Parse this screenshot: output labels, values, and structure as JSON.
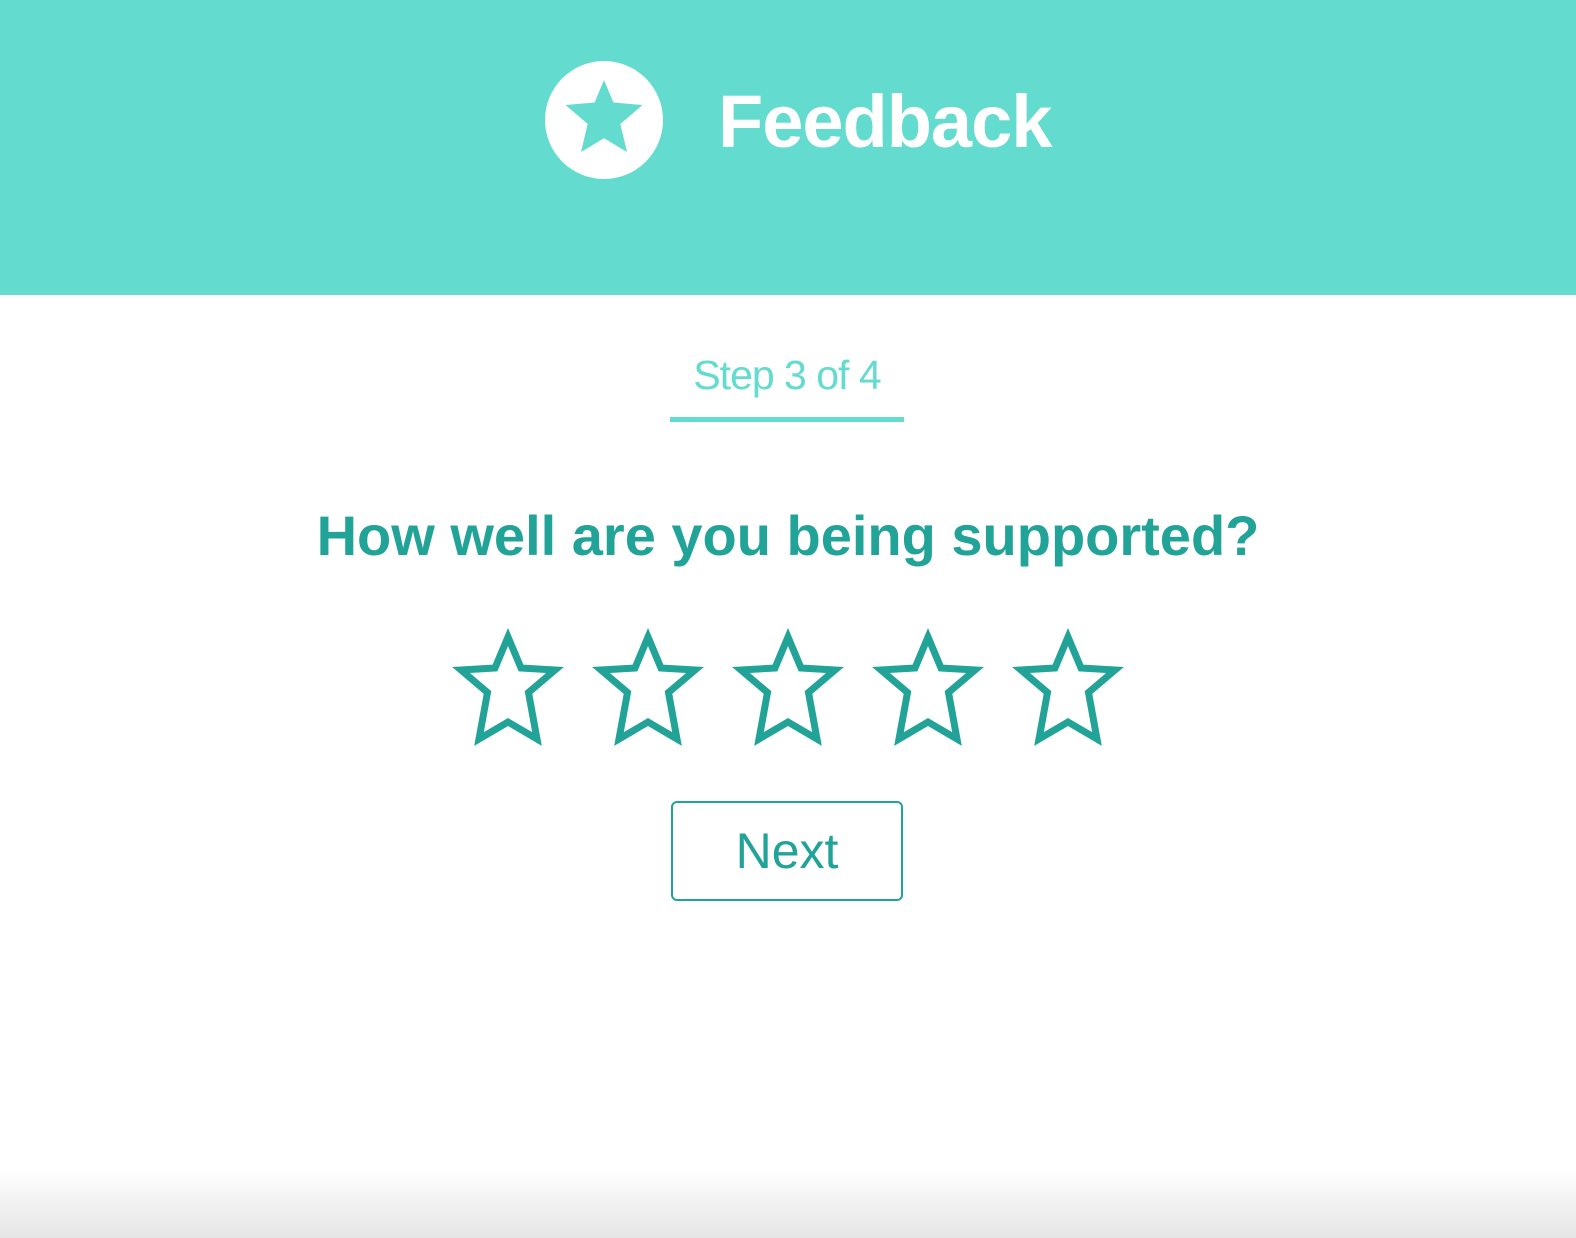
{
  "header": {
    "title": "Feedback",
    "logo_icon": "star-icon",
    "background_color": "#63dbce",
    "text_color": "#ffffff"
  },
  "progress": {
    "label": "Step 3 of 4",
    "current_step": 3,
    "total_steps": 4,
    "color": "#63dbce"
  },
  "question": {
    "text": "How well are you being supported?",
    "color": "#22a398"
  },
  "rating": {
    "max_stars": 5,
    "selected": 0,
    "star_icon": "star-outline-icon",
    "color": "#22a398"
  },
  "actions": {
    "next_label": "Next"
  }
}
